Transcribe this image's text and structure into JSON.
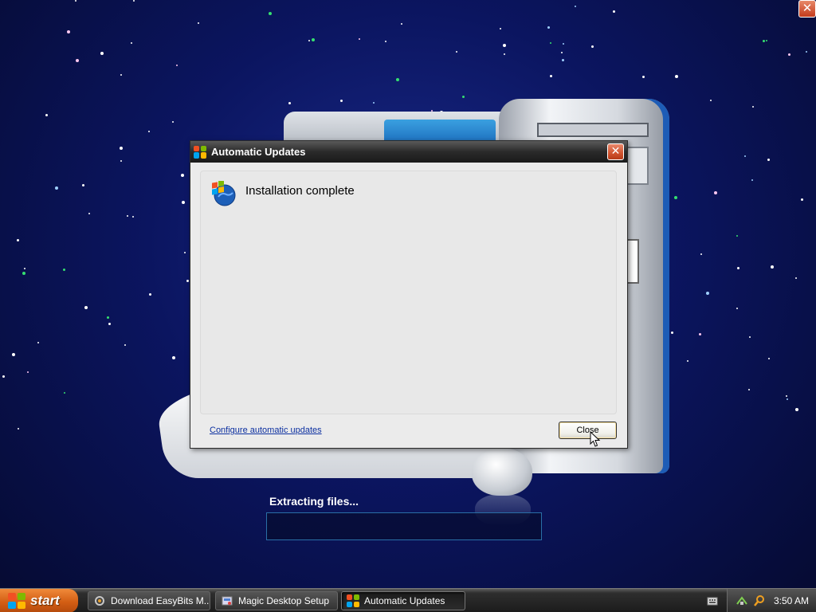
{
  "desktop": {
    "corner_close_symbol": "✕"
  },
  "extraction": {
    "label": "Extracting files...",
    "progress_percent": 0
  },
  "dialog": {
    "title": "Automatic Updates",
    "close_symbol": "✕",
    "status_text": "Installation complete",
    "configure_link": "Configure automatic updates",
    "close_button_label": "Close"
  },
  "taskbar": {
    "start_label": "start",
    "tasks": [
      {
        "label": "Download EasyBits M...",
        "icon": "easybits-icon",
        "active": false
      },
      {
        "label": "Magic Desktop Setup",
        "icon": "setup-icon",
        "active": false
      },
      {
        "label": "Automatic Updates",
        "icon": "windows-update-icon",
        "active": true
      }
    ],
    "clock": "3:50 AM"
  },
  "colors": {
    "titlebar": "#2a2a2a",
    "start_button": "#d35e14",
    "link": "#0b2fa0",
    "close_red": "#d0532e"
  }
}
